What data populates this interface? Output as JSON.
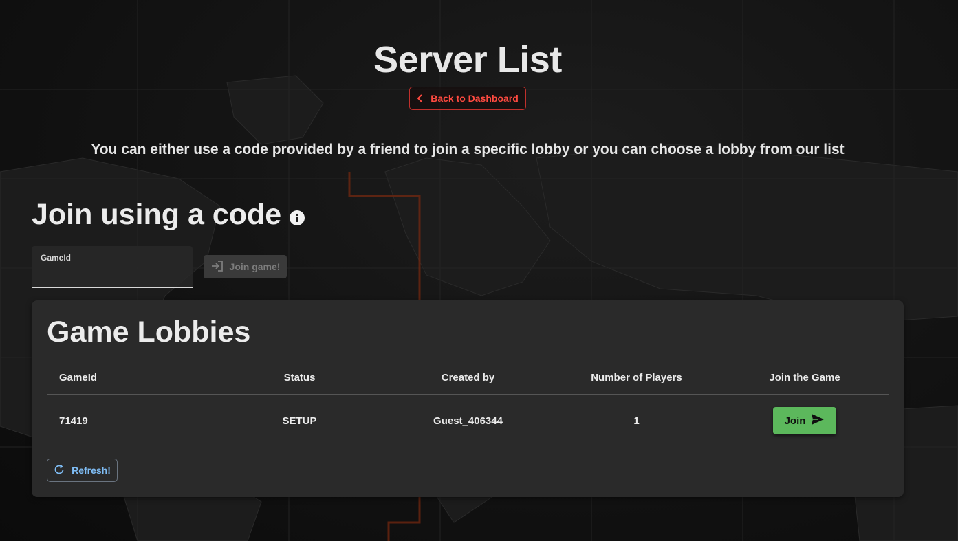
{
  "header": {
    "title": "Server List",
    "back_label": "Back to Dashboard",
    "back_icon": "chevron-left-icon"
  },
  "intro": {
    "text": "You can either use a code provided by a friend to join a specific lobby or you can choose a lobby from our list"
  },
  "join_code": {
    "heading": "Join using a code",
    "info_icon": "info-icon",
    "field_label": "GameId",
    "field_value": "",
    "button_label": "Join game!",
    "button_icon": "login-icon"
  },
  "lobbies": {
    "title": "Game Lobbies",
    "columns": [
      "GameId",
      "Status",
      "Created by",
      "Number of Players",
      "Join the Game"
    ],
    "rows": [
      {
        "game_id": "71419",
        "status": "SETUP",
        "created_by": "Guest_406344",
        "players": "1",
        "join_label": "Join"
      }
    ],
    "refresh_label": "Refresh!",
    "refresh_icon": "refresh-icon"
  },
  "colors": {
    "accent_red": "#ff4a40",
    "join_green": "#5cb85c",
    "refresh_blue": "#7fbdf5",
    "card_bg": "#2a2a2a"
  }
}
